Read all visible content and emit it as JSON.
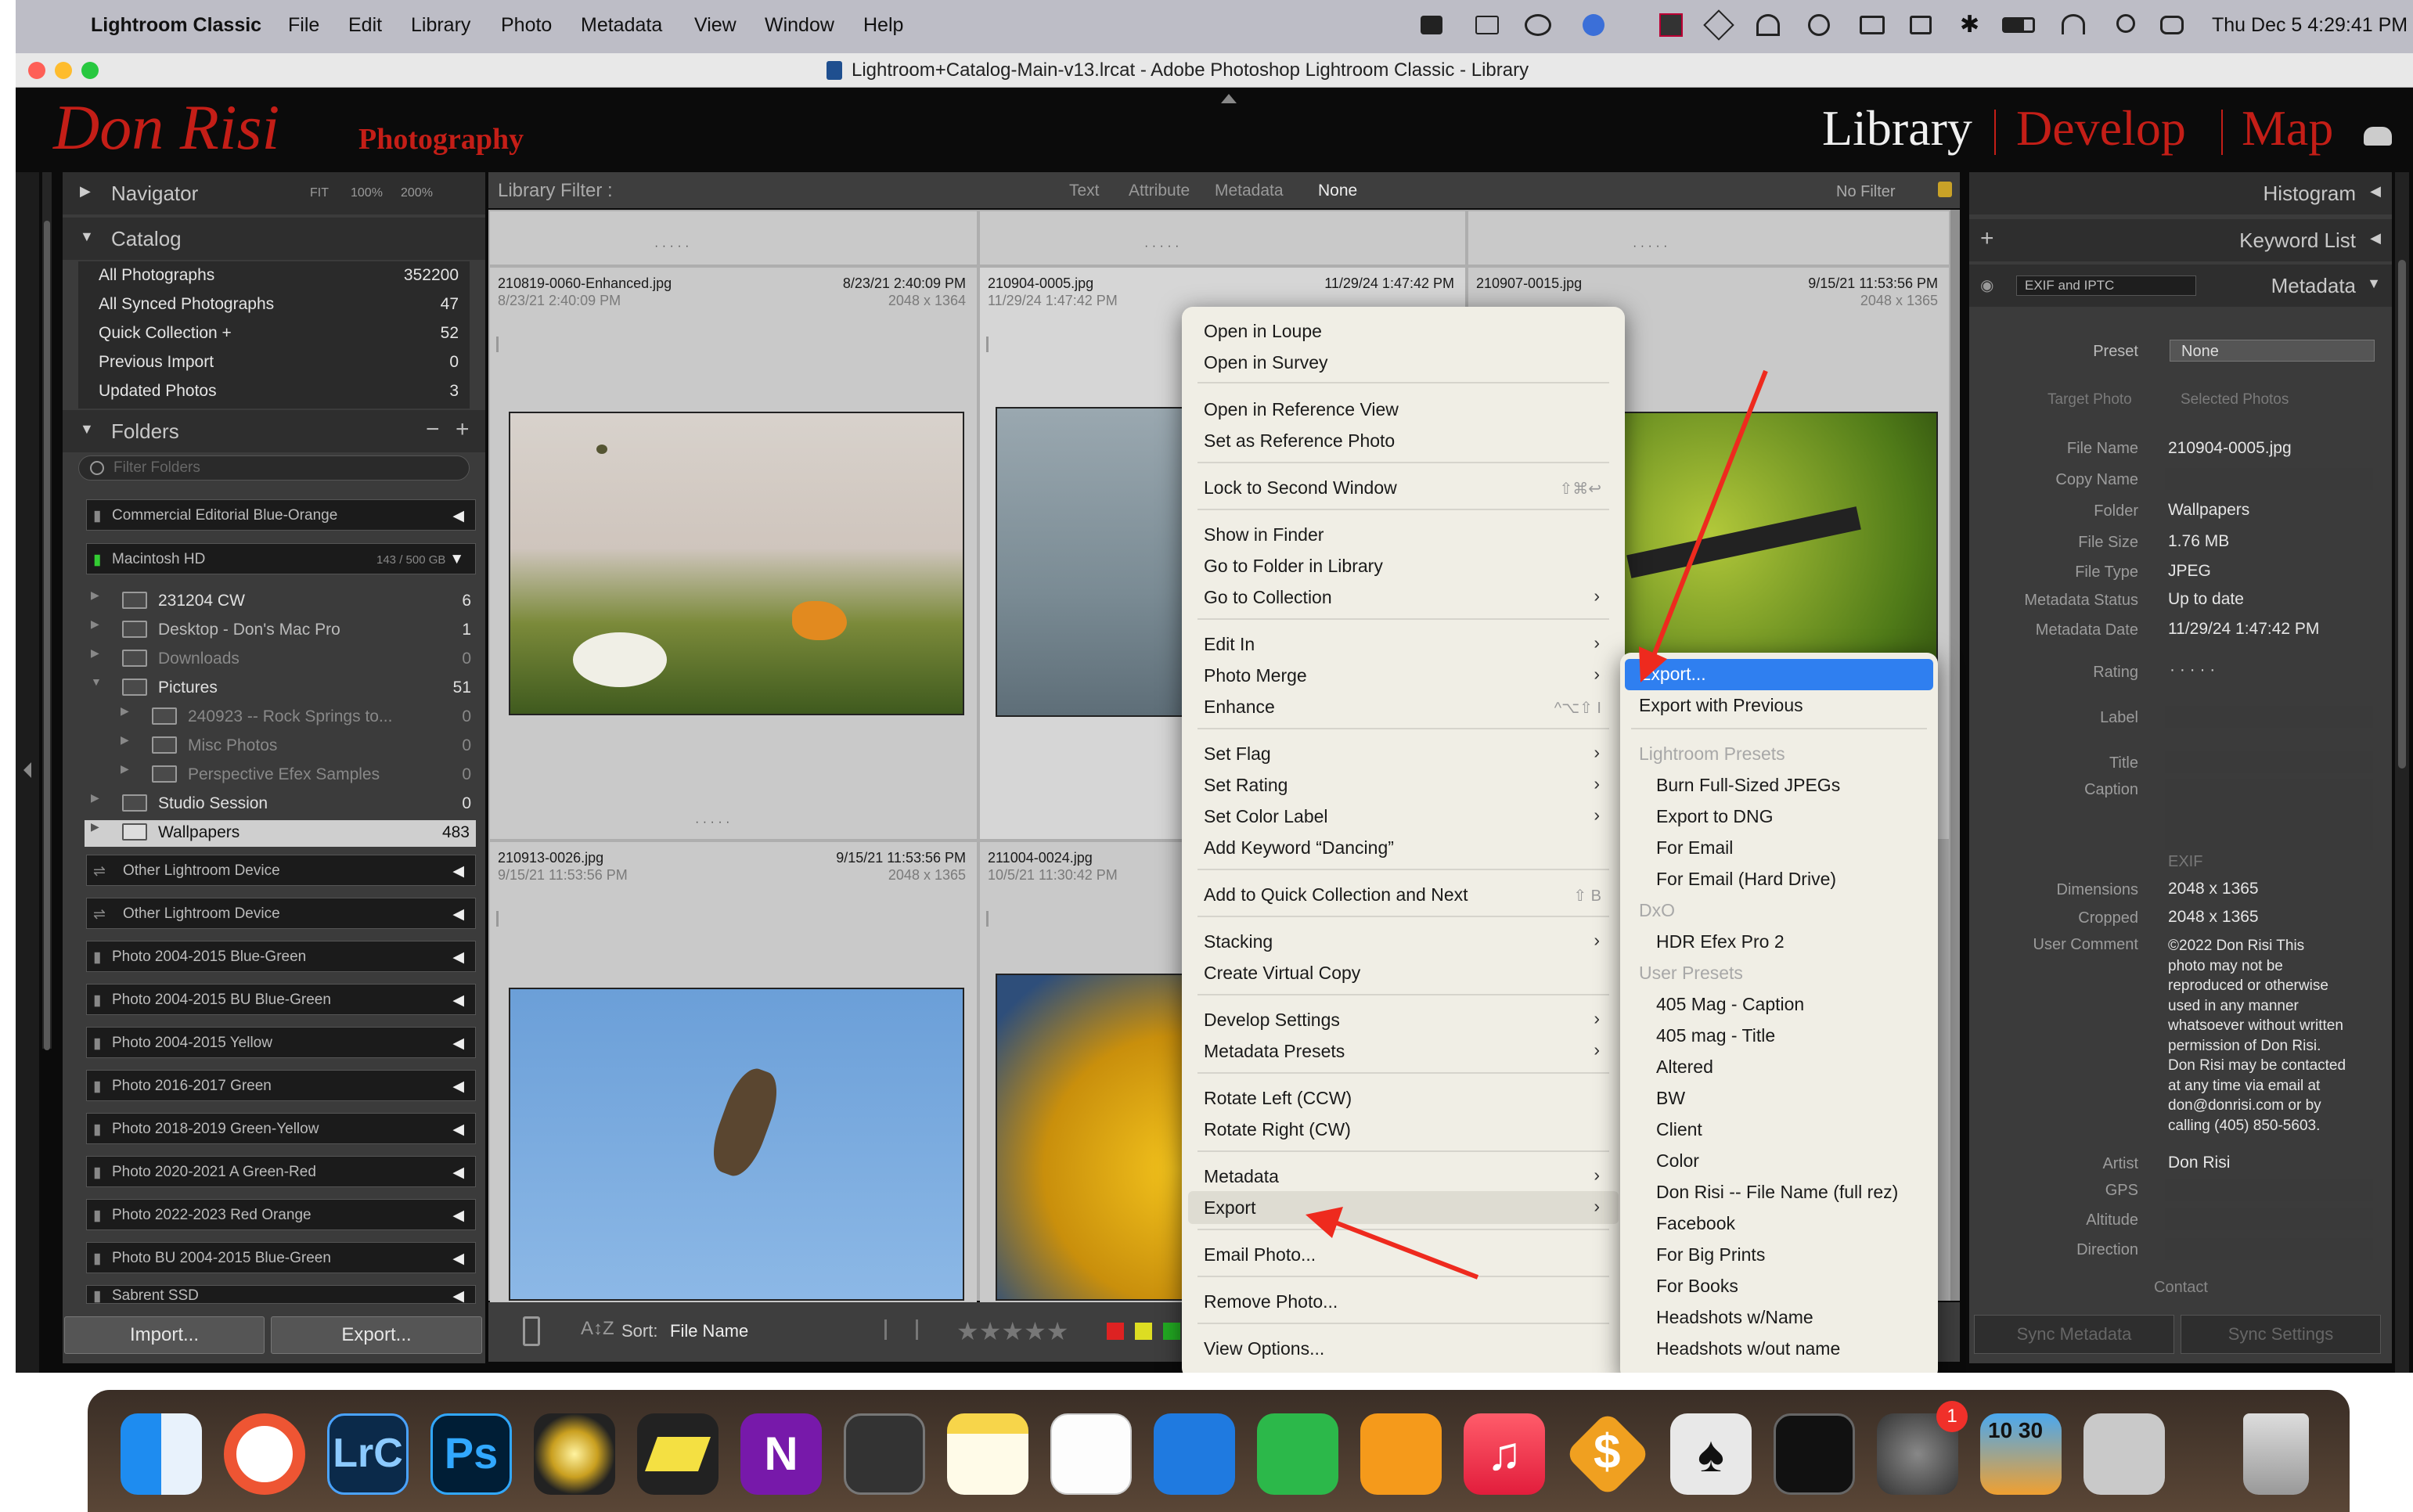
{
  "menubar": {
    "app": "Lightroom Classic",
    "items": [
      "File",
      "Edit",
      "Library",
      "Photo",
      "Metadata",
      "View",
      "Window",
      "Help"
    ],
    "datetime": "Thu Dec 5  4:29:41 PM"
  },
  "window": {
    "title": "Lightroom+Catalog-Main-v13.lrcat - Adobe Photoshop Lightroom Classic - Library"
  },
  "brand": {
    "name": "Don Risi",
    "suffix": "Photography"
  },
  "modules": [
    "Library",
    "Develop",
    "Map"
  ],
  "navigator": {
    "title": "Navigator",
    "zooms": [
      "FIT",
      "100%",
      "200%"
    ]
  },
  "catalog": {
    "title": "Catalog",
    "items": [
      {
        "label": "All Photographs",
        "count": "352200"
      },
      {
        "label": "All Synced Photographs",
        "count": "47"
      },
      {
        "label": "Quick Collection  +",
        "count": "52"
      },
      {
        "label": "Previous Import",
        "count": "0"
      },
      {
        "label": "Updated Photos",
        "count": "3"
      }
    ]
  },
  "folders": {
    "title": "Folders",
    "filter_placeholder": "Filter Folders",
    "volumes_top": [
      {
        "name": "Commercial Editorial Blue-Orange"
      },
      {
        "name": "Macintosh HD",
        "size": "143 / 500 GB"
      }
    ],
    "tree": [
      {
        "name": "231204 CW",
        "count": "6"
      },
      {
        "name": "Desktop - Don's Mac Pro",
        "count": "1"
      },
      {
        "name": "Downloads",
        "count": "0"
      },
      {
        "name": "Pictures",
        "count": "51"
      },
      {
        "name": "240923 -- Rock Springs to...",
        "count": "0"
      },
      {
        "name": "Misc Photos",
        "count": "0"
      },
      {
        "name": "Perspective Efex Samples",
        "count": "0"
      },
      {
        "name": "Studio Session",
        "count": "0"
      },
      {
        "name": "Wallpapers",
        "count": "483"
      }
    ],
    "volumes_bottom": [
      "Other Lightroom Device",
      "Other Lightroom Device",
      "Photo 2004-2015 Blue-Green",
      "Photo 2004-2015 BU Blue-Green",
      "Photo 2004-2015 Yellow",
      "Photo 2016-2017 Green",
      "Photo 2018-2019 Green-Yellow",
      "Photo 2020-2021 A Green-Red",
      "Photo 2022-2023 Red Orange",
      "Photo BU 2004-2015 Blue-Green",
      "Sabrent SSD"
    ]
  },
  "buttons": {
    "import": "Import...",
    "export": "Export..."
  },
  "filter": {
    "title": "Library Filter :",
    "tabs": [
      "Text",
      "Attribute",
      "Metadata",
      "None"
    ],
    "preset": "No Filter"
  },
  "grid": [
    {
      "file": "210819-0060-Enhanced.jpg",
      "date": "8/23/21 2:40:09 PM",
      "date2": "8/23/21 2:40:09 PM",
      "dim": "2048 x 1364"
    },
    {
      "file": "210904-0005.jpg",
      "date": "11/29/24 1:47:42 PM",
      "date2": "11/29/24 1:47:42 PM",
      "dim": ""
    },
    {
      "file": "210907-0015.jpg",
      "date": "9/15/21 11:53:56 PM",
      "date2": "",
      "dim": "2048 x 1365"
    },
    {
      "file": "210913-0026.jpg",
      "date": "9/15/21 11:53:56 PM",
      "date2": "9/15/21 11:53:56 PM",
      "dim": "2048 x 1365"
    },
    {
      "file": "211004-0024.jpg",
      "date": "",
      "date2": "10/5/21 11:30:42 PM",
      "dim": ""
    }
  ],
  "toolbar": {
    "sort_label": "Sort:",
    "sort_value": "File Name"
  },
  "context_menu": {
    "groups": [
      [
        "Open in Loupe",
        "Open in Survey"
      ],
      [
        "Open in Reference View",
        "Set as Reference Photo"
      ],
      [
        "Lock to Second Window"
      ],
      [
        "Show in Finder",
        "Go to Folder in Library",
        "Go to Collection"
      ],
      [
        "Edit In",
        "Photo Merge",
        "Enhance"
      ],
      [
        "Set Flag",
        "Set Rating",
        "Set Color Label",
        "Add Keyword “Dancing”"
      ],
      [
        "Add to Quick Collection and Next"
      ],
      [
        "Stacking",
        "Create Virtual Copy"
      ],
      [
        "Develop Settings",
        "Metadata Presets"
      ],
      [
        "Rotate Left (CCW)",
        "Rotate Right (CW)"
      ],
      [
        "Metadata",
        "Export"
      ],
      [
        "Email Photo..."
      ],
      [
        "Remove Photo..."
      ],
      [
        "View Options..."
      ]
    ],
    "shortcuts": {
      "lock": "⇧⌘↩",
      "enhance": "^⌥⇧ I",
      "quick": "⇧ B"
    }
  },
  "export_menu": {
    "top": [
      "Export...",
      "Export with Previous"
    ],
    "sections": [
      {
        "header": "Lightroom Presets",
        "items": [
          "Burn Full-Sized JPEGs",
          "Export to DNG",
          "For Email",
          "For Email (Hard Drive)"
        ]
      },
      {
        "header": "DxO",
        "items": [
          "HDR Efex Pro 2"
        ]
      },
      {
        "header": "User Presets",
        "items": [
          "405 Mag - Caption",
          "405 mag - Title",
          "Altered",
          "BW",
          "Client",
          "Color",
          "Don Risi -- File Name (full rez)",
          "Facebook",
          "For Big Prints",
          "For Books",
          "Headshots w/Name",
          "Headshots w/out name"
        ]
      }
    ]
  },
  "right_panel": {
    "histogram": "Histogram",
    "keyword_list": "Keyword List",
    "metadata": "Metadata",
    "metadata_set": "EXIF and IPTC",
    "preset_label": "Preset",
    "preset_value": "None",
    "target": "Target Photo",
    "selected": "Selected Photos",
    "fields": [
      {
        "label": "File Name",
        "value": "210904-0005.jpg"
      },
      {
        "label": "Copy Name",
        "value": ""
      },
      {
        "label": "Folder",
        "value": "Wallpapers"
      },
      {
        "label": "File Size",
        "value": "1.76 MB"
      },
      {
        "label": "File Type",
        "value": "JPEG"
      },
      {
        "label": "Metadata Status",
        "value": "Up to date"
      },
      {
        "label": "Metadata Date",
        "value": "11/29/24 1:47:42 PM"
      },
      {
        "label": "Rating",
        "value": "·  ·  ·  ·  ·"
      },
      {
        "label": "Label",
        "value": ""
      },
      {
        "label": "Title",
        "value": ""
      },
      {
        "label": "Caption",
        "value": ""
      }
    ],
    "exif_header": "EXIF",
    "exif": [
      {
        "label": "Dimensions",
        "value": "2048 x 1365"
      },
      {
        "label": "Cropped",
        "value": "2048 x 1365"
      }
    ],
    "comment_label": "User Comment",
    "comment": [
      "©2022 Don Risi  This",
      "photo may not be",
      "reproduced or otherwise",
      "used in any manner",
      "whatsoever without written",
      "permission of Don Risi.",
      "Don Risi may be contacted",
      "at any time via email at",
      "don@donrisi.com or by",
      "calling (405) 850-5603."
    ],
    "artist_label": "Artist",
    "artist": "Don Risi",
    "gps": "GPS",
    "altitude": "Altitude",
    "direction": "Direction",
    "contact": "Contact",
    "sync_metadata": "Sync Metadata",
    "sync_settings": "Sync Settings"
  },
  "dock": {
    "badge": "1",
    "calendar": "10 30"
  },
  "colors": {
    "accent_red": "#c41e17",
    "menu_highlight": "#2f7ff0",
    "panel": "#3b3b3b"
  }
}
